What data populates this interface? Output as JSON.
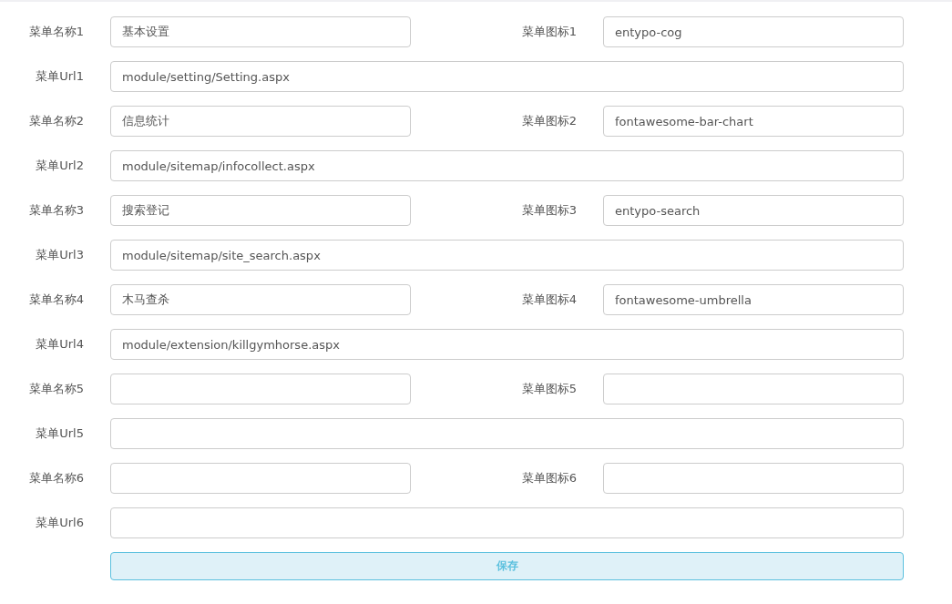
{
  "menus": [
    {
      "name_label": "菜单名称1",
      "name": "基本设置",
      "icon_label": "菜单图标1",
      "icon": "entypo-cog",
      "url_label": "菜单Url1",
      "url": "module/setting/Setting.aspx"
    },
    {
      "name_label": "菜单名称2",
      "name": "信息统计",
      "icon_label": "菜单图标2",
      "icon": "fontawesome-bar-chart",
      "url_label": "菜单Url2",
      "url": "module/sitemap/infocollect.aspx"
    },
    {
      "name_label": "菜单名称3",
      "name": "搜索登记",
      "icon_label": "菜单图标3",
      "icon": "entypo-search",
      "url_label": "菜单Url3",
      "url": "module/sitemap/site_search.aspx"
    },
    {
      "name_label": "菜单名称4",
      "name": "木马查杀",
      "icon_label": "菜单图标4",
      "icon": "fontawesome-umbrella",
      "url_label": "菜单Url4",
      "url": "module/extension/killgymhorse.aspx"
    },
    {
      "name_label": "菜单名称5",
      "icon_label": "菜单图标5",
      "url_label": "菜单Url5"
    },
    {
      "name_label": "菜单名称6",
      "icon_label": "菜单图标6",
      "url_label": "菜单Url6"
    }
  ],
  "save_button": "保存"
}
